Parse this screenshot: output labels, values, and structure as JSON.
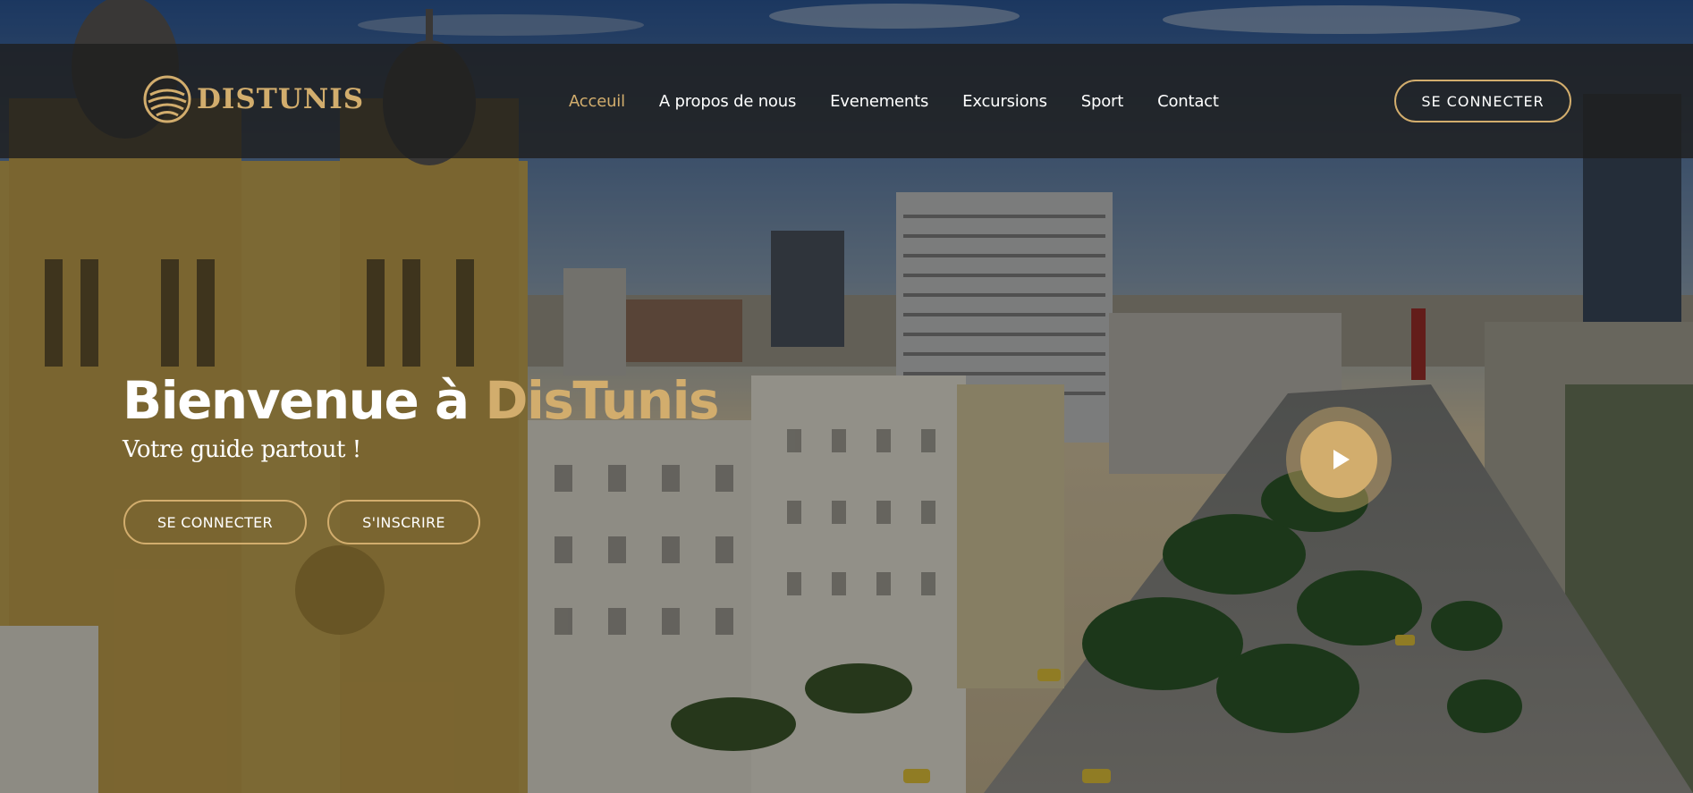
{
  "brand": {
    "name": "DISTUNIS",
    "accent_color": "#d2ad6d"
  },
  "nav": {
    "items": [
      {
        "label": "Acceuil",
        "active": true
      },
      {
        "label": "A propos de nous",
        "active": false
      },
      {
        "label": "Evenements",
        "active": false
      },
      {
        "label": "Excursions",
        "active": false
      },
      {
        "label": "Sport",
        "active": false
      },
      {
        "label": "Contact",
        "active": false
      }
    ],
    "login_label": "SE CONNECTER"
  },
  "hero": {
    "title_prefix": "Bienvenue à ",
    "title_accent": "DisTunis",
    "subtitle": "Votre guide partout !",
    "login_label": "SE CONNECTER",
    "register_label": "S'INSCRIRE",
    "play_icon": "play-icon"
  }
}
